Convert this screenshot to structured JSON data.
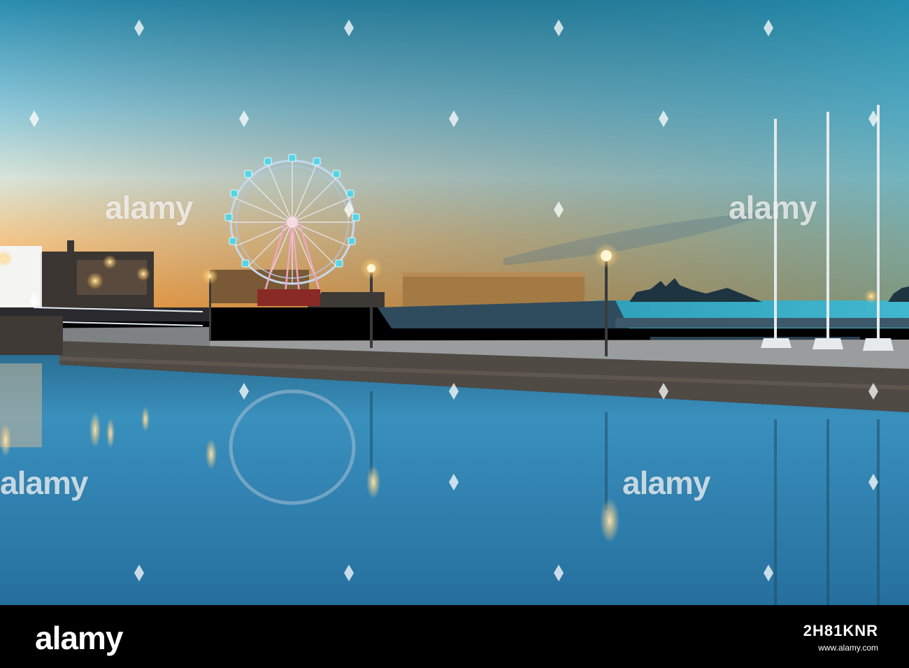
{
  "watermark": {
    "text": "alamy"
  },
  "footer": {
    "logo": "alamy",
    "image_id": "2H81KNR",
    "url": "www.alamy.com"
  },
  "scene": {
    "subject": "Ferris wheel at harbour at dusk with reflections in calm water",
    "colors": {
      "sky_top": "#2e8fb2",
      "sky_mid": "#9fd0de",
      "horizon": "#f7b25a",
      "water": "#2f8cbf",
      "wheel_lights": "#55d4e6"
    }
  }
}
